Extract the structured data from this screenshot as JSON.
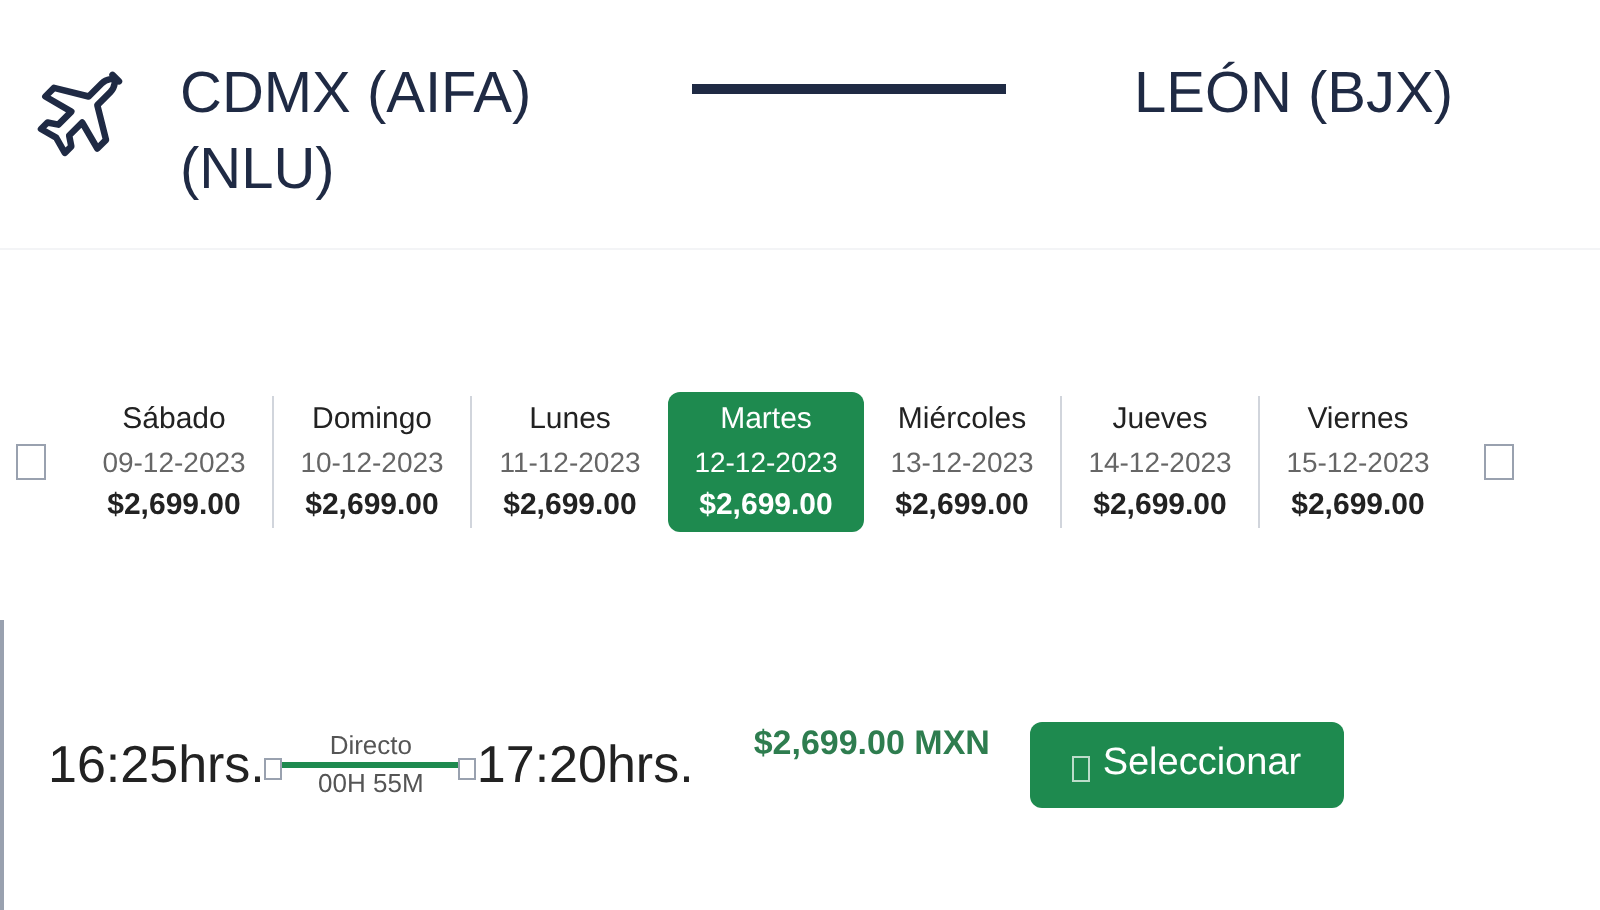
{
  "route": {
    "origin": "CDMX (AIFA) (NLU)",
    "destination": "LEÓN (BJX)"
  },
  "days": [
    {
      "day": "Sábado",
      "date": "09-12-2023",
      "price": "$2,699.00",
      "selected": false
    },
    {
      "day": "Domingo",
      "date": "10-12-2023",
      "price": "$2,699.00",
      "selected": false
    },
    {
      "day": "Lunes",
      "date": "11-12-2023",
      "price": "$2,699.00",
      "selected": false
    },
    {
      "day": "Martes",
      "date": "12-12-2023",
      "price": "$2,699.00",
      "selected": true
    },
    {
      "day": "Miércoles",
      "date": "13-12-2023",
      "price": "$2,699.00",
      "selected": false
    },
    {
      "day": "Jueves",
      "date": "14-12-2023",
      "price": "$2,699.00",
      "selected": false
    },
    {
      "day": "Viernes",
      "date": "15-12-2023",
      "price": "$2,699.00",
      "selected": false
    }
  ],
  "flight": {
    "departure": "16:25hrs.",
    "stops": "Directo",
    "duration": "00H 55M",
    "arrival": "17:20hrs.",
    "price": "$2,699.00 MXN",
    "button": "Seleccionar"
  }
}
